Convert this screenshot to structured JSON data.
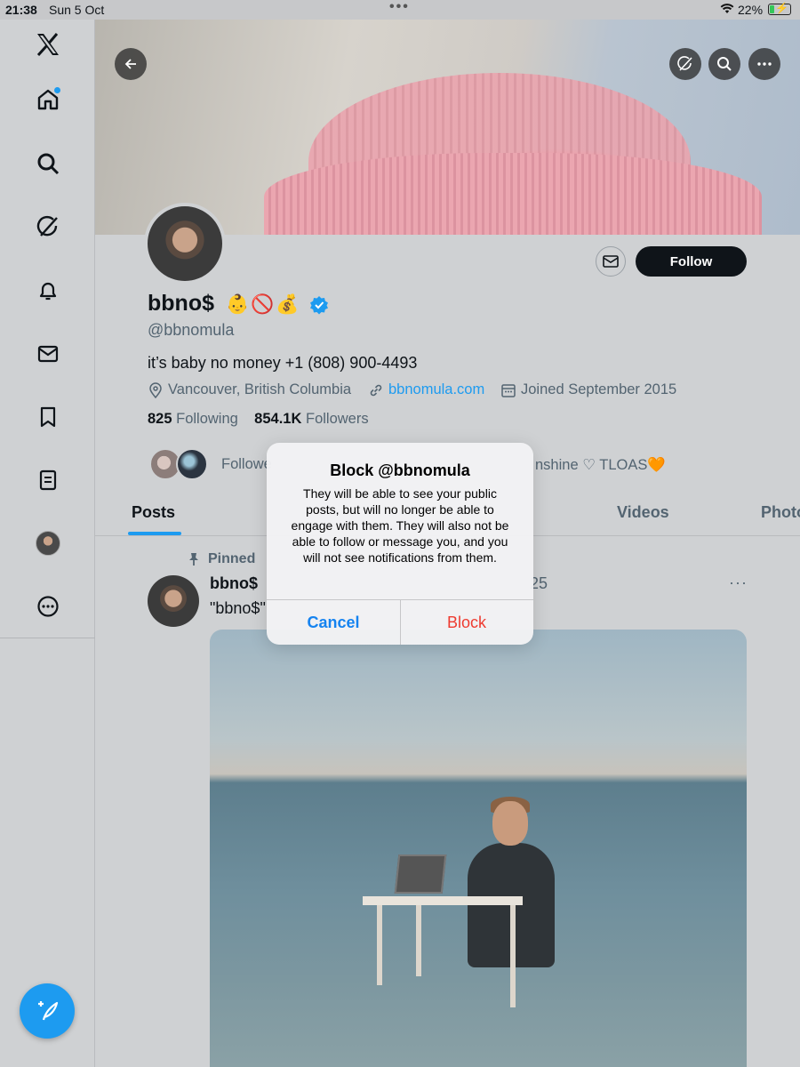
{
  "status_bar": {
    "time": "21:38",
    "date": "Sun 5 Oct",
    "dots": "•••",
    "battery": "22%",
    "battery_level": 0.22
  },
  "sidebar": {
    "items": [
      {
        "name": "x-logo-icon"
      },
      {
        "name": "home-icon"
      },
      {
        "name": "search-icon"
      },
      {
        "name": "grok-icon"
      },
      {
        "name": "notifications-icon"
      },
      {
        "name": "messages-icon"
      },
      {
        "name": "bookmarks-icon"
      },
      {
        "name": "lists-icon"
      },
      {
        "name": "profile-avatar"
      },
      {
        "name": "more-icon"
      }
    ],
    "compose_icon": "compose-icon",
    "accent": "#1d9bf0"
  },
  "profile": {
    "name": "bbno$",
    "emojis": "👶🚫💰",
    "handle": "@bbnomula",
    "bio": "it’s baby no money +1 (808) 900-4493",
    "location": "Vancouver, British Columbia",
    "website": "bbnomula.com",
    "joined": "Joined September 2015",
    "following_count": "825",
    "following_label": "Following",
    "followers_count": "854.1K",
    "followers_label": "Followers",
    "followed_by_left": "Followe",
    "followed_by_right": "nshine ♡ TLOAS🧡",
    "follow_button": "Follow"
  },
  "tabs": [
    {
      "label": "Posts",
      "active": true
    },
    {
      "label": "Videos",
      "active": false
    },
    {
      "label": "Photo",
      "active": false
    }
  ],
  "post": {
    "pinned_label": "Pinned",
    "author": "bbno$",
    "date_fragment": "25",
    "text_fragment": "\"bbno$\"",
    "more": "···"
  },
  "dialog": {
    "title": "Block @bbnomula",
    "message": "They will be able to see your public posts, but will no longer be able to engage with them. They will also not be able to follow or message you, and you will not see notifications from them.",
    "cancel_label": "Cancel",
    "block_label": "Block"
  }
}
